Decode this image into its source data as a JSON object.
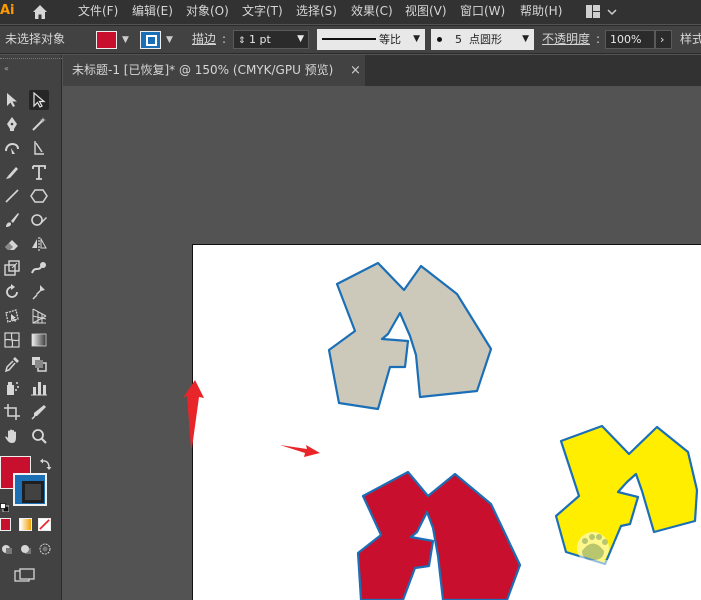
{
  "app": {
    "logo_text": "Ai"
  },
  "menu": {
    "items": [
      "文件(F)",
      "编辑(E)",
      "对象(O)",
      "文字(T)",
      "选择(S)",
      "效果(C)",
      "视图(V)",
      "窗口(W)",
      "帮助(H)"
    ]
  },
  "control_bar": {
    "selection_status": "未选择对象",
    "stroke_label": "描边",
    "stroke_weight": "1 pt",
    "stroke_profile": "等比",
    "brush_size": "5",
    "brush_label": "点圆形",
    "opacity_label": "不透明度",
    "opacity_value": "100%",
    "style_label": "样式",
    "fill_color": "#c8102e",
    "stroke_color": "#1b6fb7"
  },
  "document": {
    "tab_title": "未标题-1 [已恢复]* @ 150% (CMYK/GPU 预览)",
    "close_symbol": "×"
  },
  "colors": {
    "shape_gray": "#ccc9bb",
    "shape_red": "#c8102e",
    "shape_yellow": "#ffee00",
    "shape_stroke": "#1b6fb7",
    "arrow_red": "#e8262a"
  }
}
